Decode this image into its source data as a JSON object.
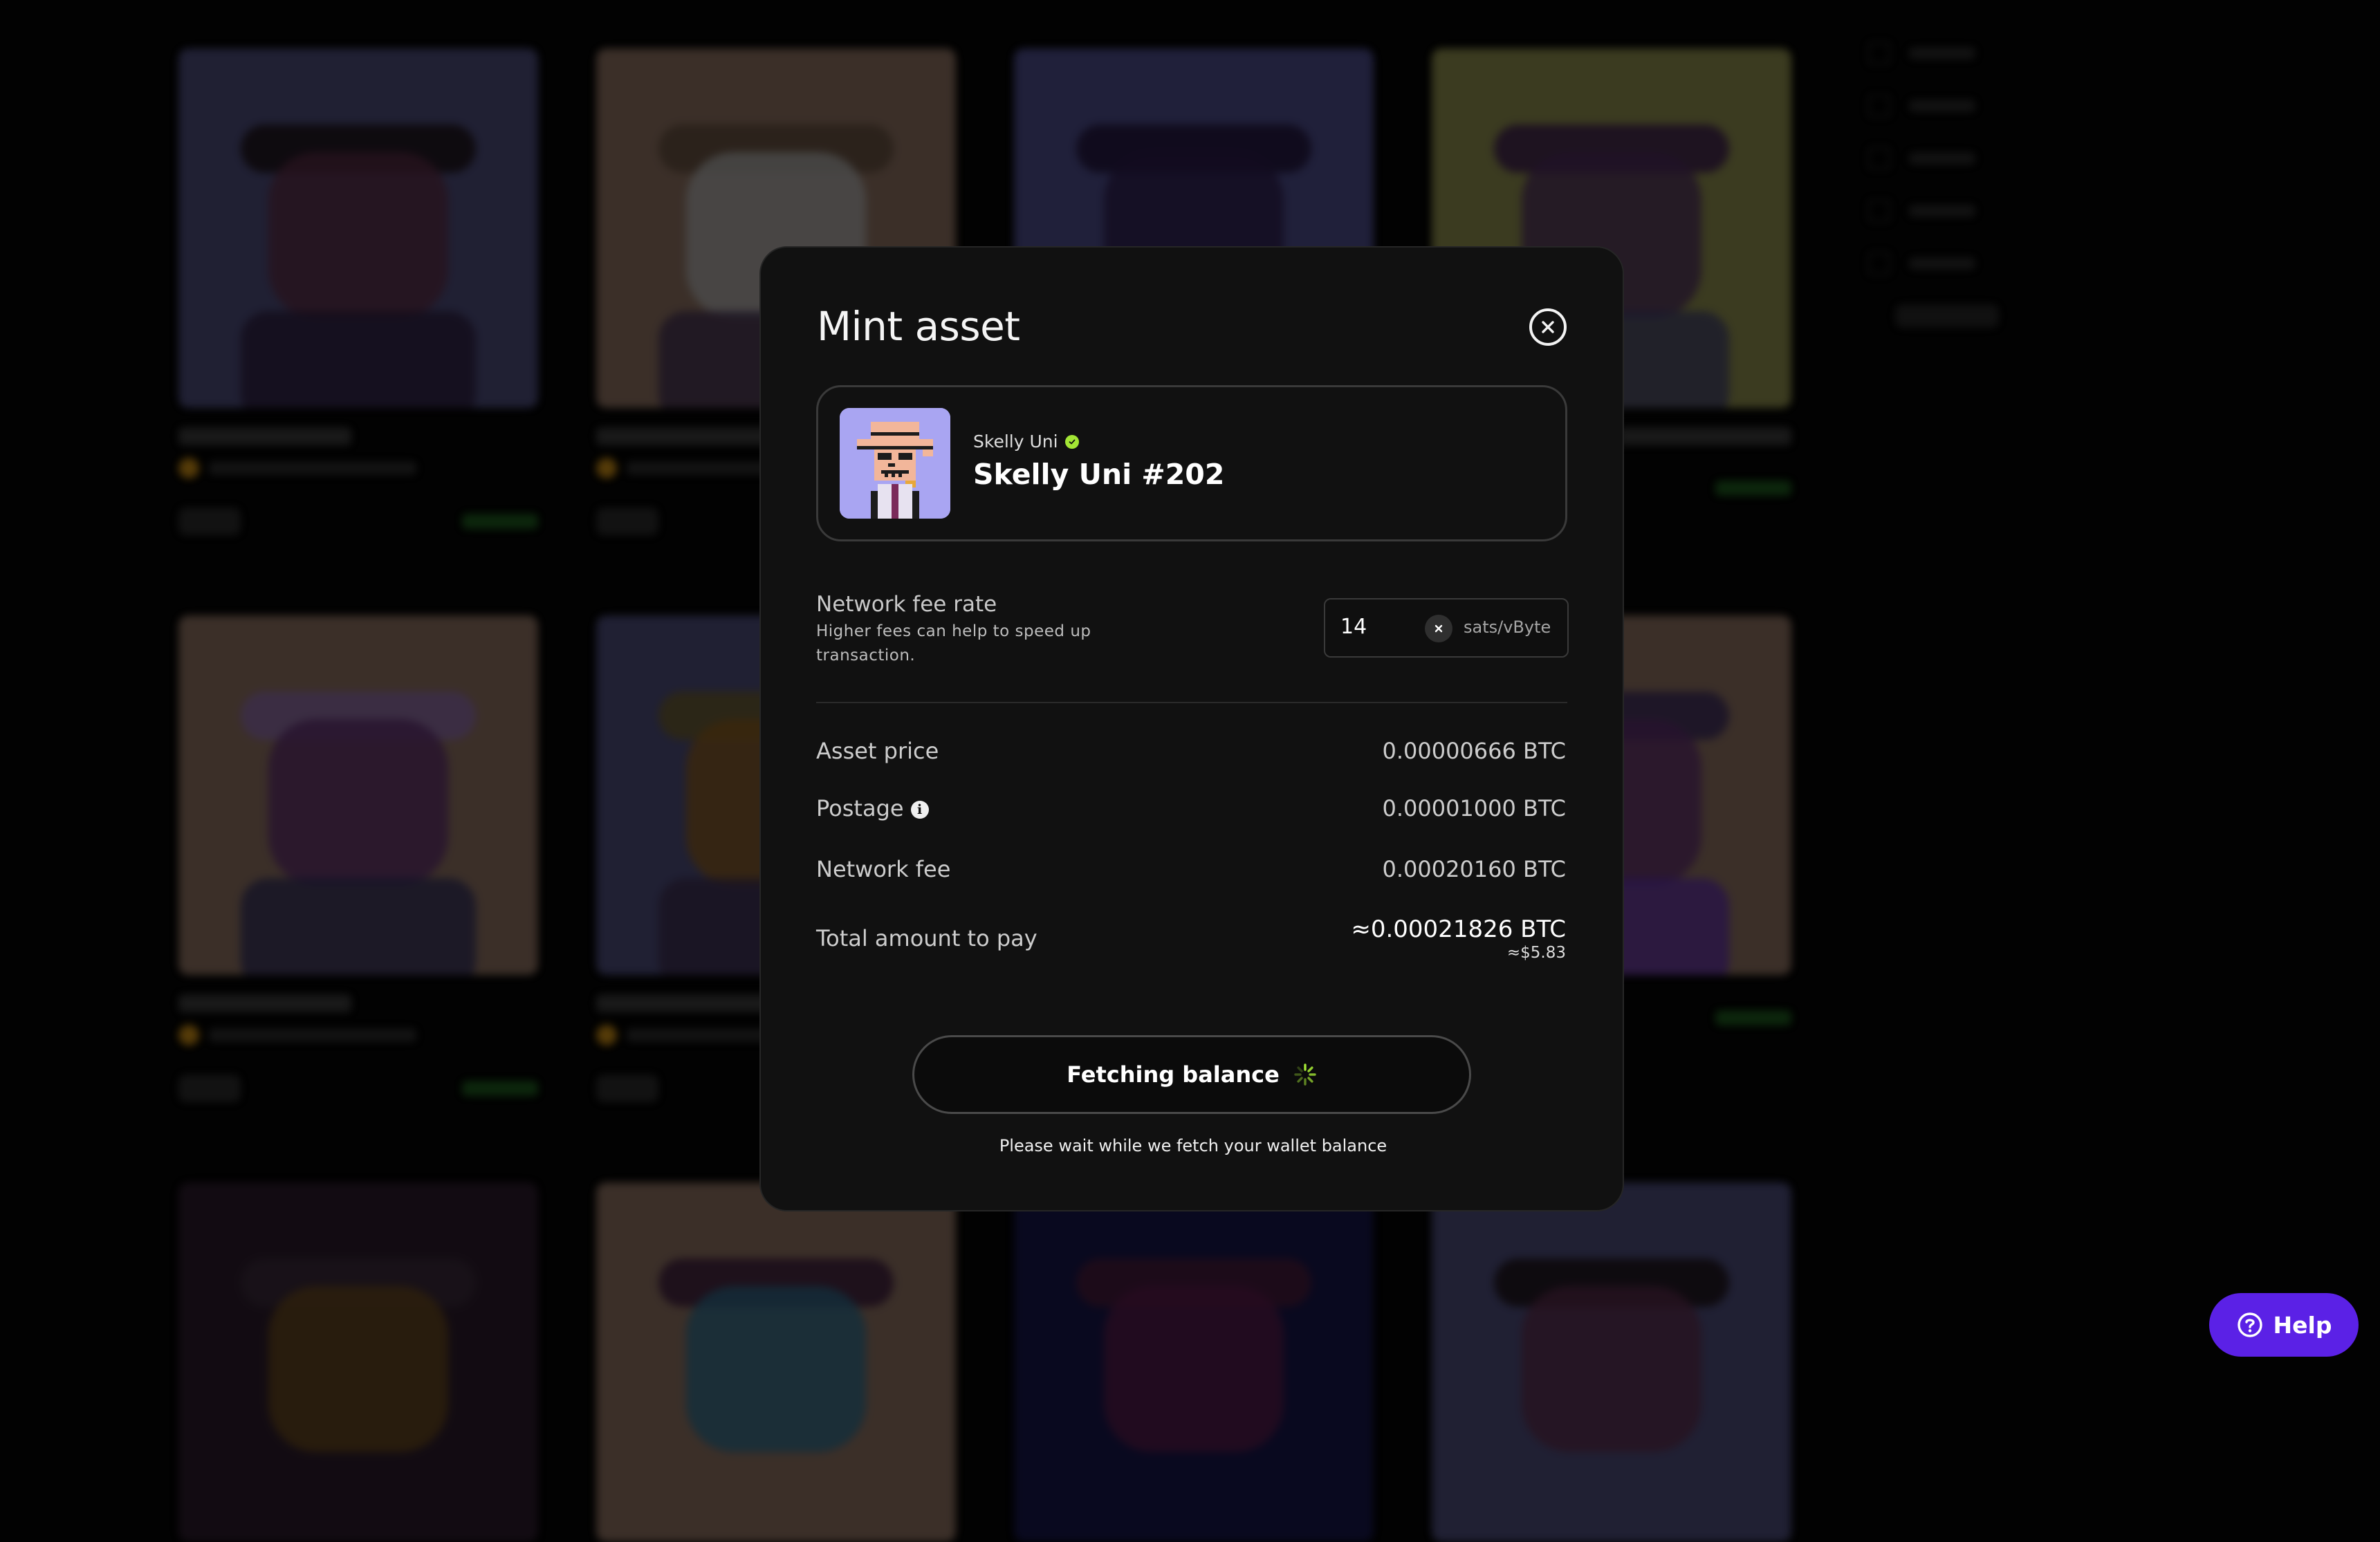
{
  "modal": {
    "title": "Mint asset",
    "asset": {
      "collection": "Skelly Uni",
      "name": "Skelly Uni #202"
    },
    "fee_rate": {
      "label": "Network fee rate",
      "help": "Higher fees can help to speed up transaction.",
      "value": "14",
      "unit": "sats/vByte"
    },
    "summary": {
      "asset_price_label": "Asset price",
      "asset_price_value": "0.00000666 BTC",
      "postage_label": "Postage",
      "postage_value": "0.00001000 BTC",
      "network_fee_label": "Network fee",
      "network_fee_value": "0.00020160 BTC",
      "total_label": "Total amount to pay",
      "total_value": "≈0.00021826 BTC",
      "total_usd": "≈$5.83"
    },
    "action": {
      "button_label": "Fetching balance",
      "wait_text": "Please wait while we fetch your wallet balance"
    }
  },
  "help": {
    "label": "Help"
  },
  "colors": {
    "accent_green": "#a3e635",
    "help_purple": "#5b21e6",
    "modal_bg": "#111111"
  },
  "icons": [
    "close-icon",
    "verified-icon",
    "clear-icon",
    "info-icon",
    "spinner-icon",
    "help-icon"
  ]
}
